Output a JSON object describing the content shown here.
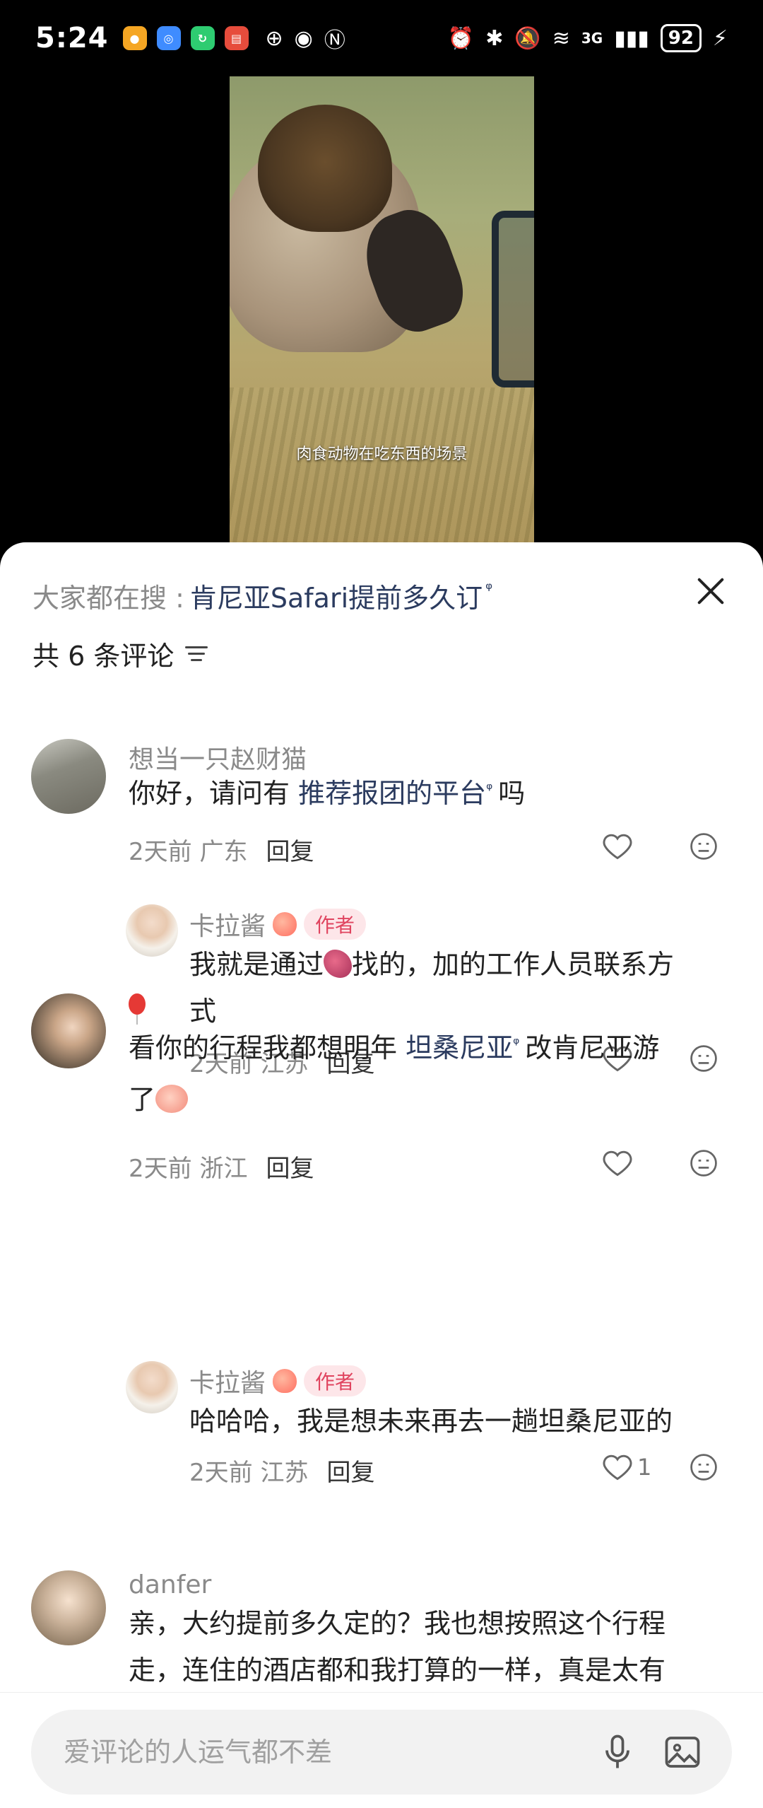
{
  "status_bar": {
    "time": "5:24",
    "network": "3G",
    "battery": "92"
  },
  "video": {
    "caption": "肉食动物在吃东西的场景"
  },
  "sheet": {
    "search_prefix": "大家都在搜 :",
    "search_link": "肯尼亚Safari提前多久订",
    "comment_count": "共 6 条评论"
  },
  "comments": [
    {
      "user": "想当一只赵财猫",
      "text_before": "你好，请问有 ",
      "link": "推荐报团的平台",
      "text_after": "吗",
      "time_loc": "2天前 广东",
      "reply": "回复",
      "likes": ""
    },
    {
      "user": "卡拉酱",
      "badge": "作者",
      "text_line1": "我就是通过",
      "text_line1b": "找的，加的工作人员联系方",
      "text_line2": "式",
      "time_loc": "2天前 江苏",
      "reply": "回复",
      "likes": ""
    },
    {
      "user": "",
      "text_before": "看你的行程我都想明年 ",
      "link": "坦桑尼亚",
      "text_after": "改肯尼亚游",
      "text_line2": "了",
      "time_loc": "2天前 浙江",
      "reply": "回复",
      "likes": ""
    },
    {
      "user": "卡拉酱",
      "badge": "作者",
      "text_line1": "哈哈哈，我是想未来再去一趟坦桑尼亚的",
      "time_loc": "2天前 江苏",
      "reply": "回复",
      "likes": "1"
    },
    {
      "user": "danfer",
      "text_line1": "亲，大约提前多久定的？我也想按照这个行程",
      "text_line2": "走，连住的酒店都和我打算的一样，真是太有"
    }
  ],
  "input": {
    "placeholder": "爱评论的人运气都不差"
  }
}
